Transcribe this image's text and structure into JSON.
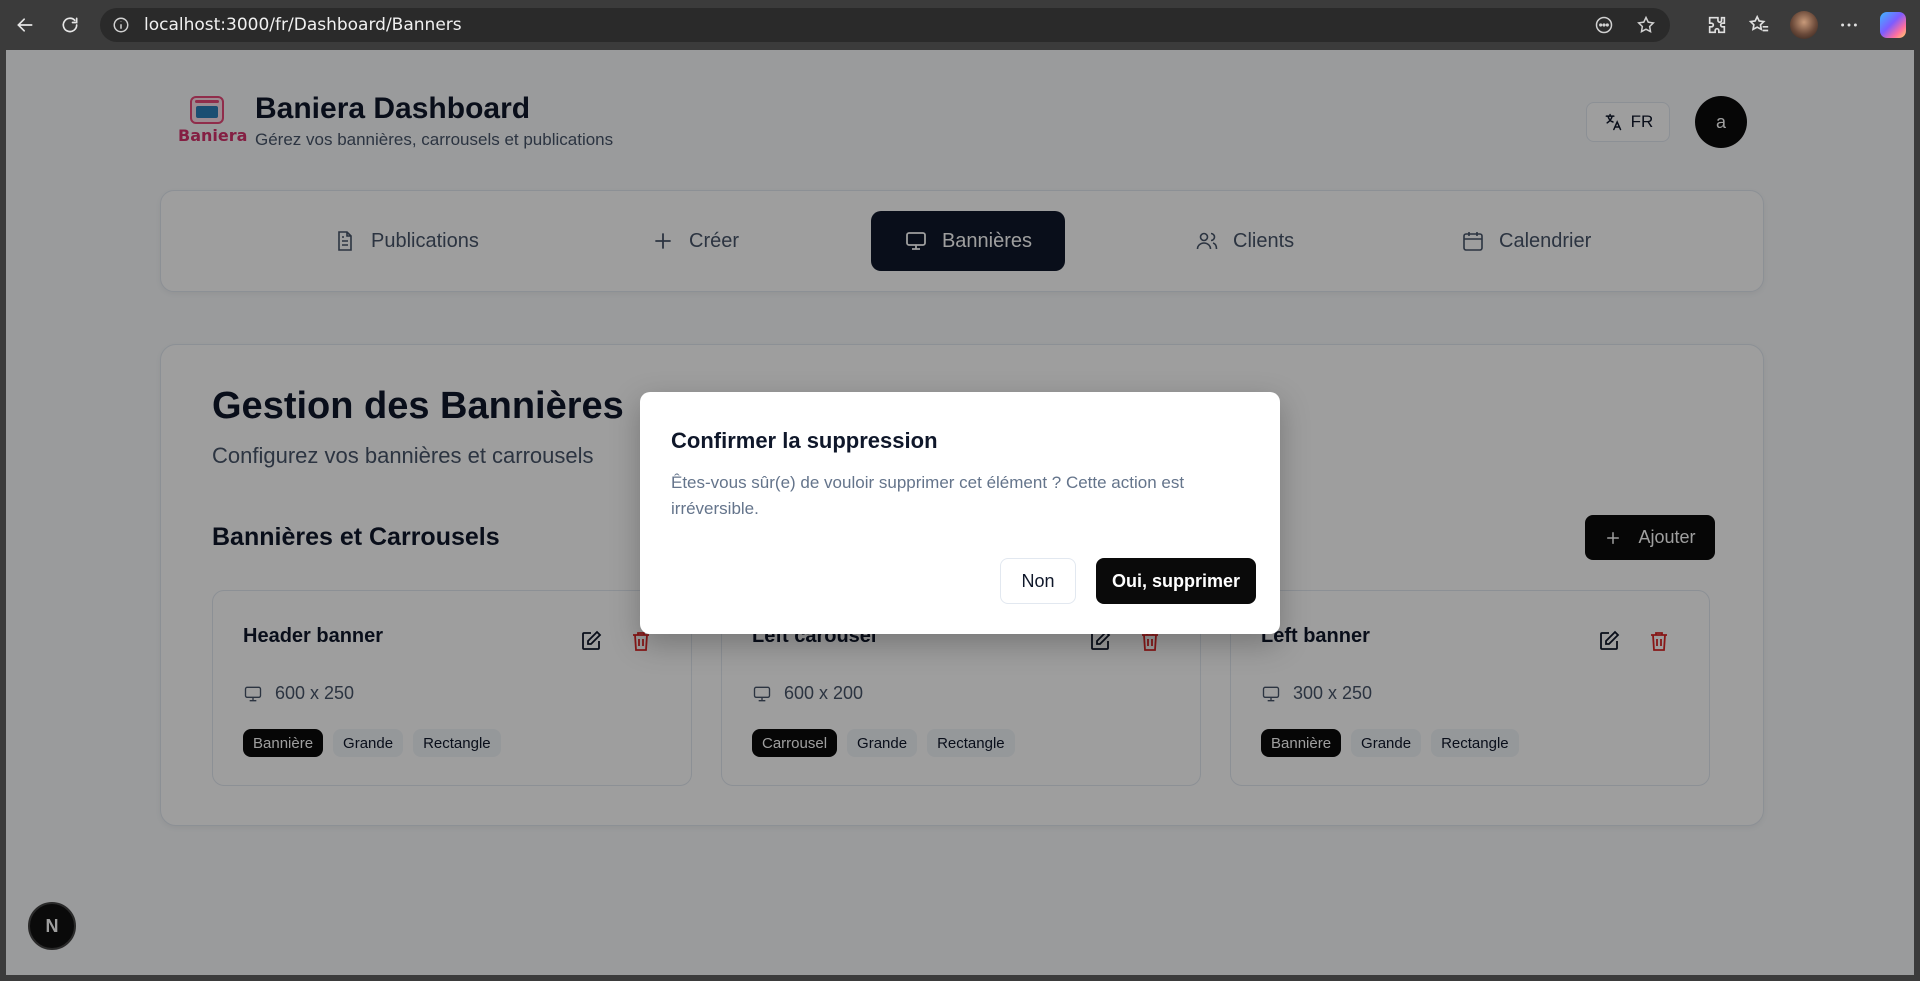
{
  "browser": {
    "url": "localhost:3000/fr/Dashboard/Banners"
  },
  "header": {
    "logo_text": "Baniera",
    "title": "Baniera Dashboard",
    "subtitle": "Gérez vos bannières, carrousels et publications",
    "language": "FR",
    "avatar_letter": "a"
  },
  "nav": {
    "items": [
      {
        "label": "Publications",
        "icon": "file-text-icon"
      },
      {
        "label": "Créer",
        "icon": "plus-icon"
      },
      {
        "label": "Bannières",
        "icon": "monitor-icon",
        "active": true
      },
      {
        "label": "Clients",
        "icon": "users-icon"
      },
      {
        "label": "Calendrier",
        "icon": "calendar-icon"
      }
    ]
  },
  "main": {
    "title": "Gestion des Bannières",
    "subtitle": "Configurez vos bannières et carrousels",
    "section_title": "Bannières et Carrousels",
    "add_label": "Ajouter",
    "cards": [
      {
        "name": "Header banner",
        "size": "600 x 250",
        "tags": [
          "Bannière",
          "Grande",
          "Rectangle"
        ]
      },
      {
        "name": "Left carousel",
        "size": "600 x 200",
        "tags": [
          "Carrousel",
          "Grande",
          "Rectangle"
        ]
      },
      {
        "name": "Left banner",
        "size": "300 x 250",
        "tags": [
          "Bannière",
          "Grande",
          "Rectangle"
        ]
      }
    ]
  },
  "dev_badge": "N",
  "dialog": {
    "title": "Confirmer la suppression",
    "text": "Êtes-vous sûr(e) de vouloir supprimer cet élément ? Cette action est irréversible.",
    "cancel_label": "Non",
    "confirm_label": "Oui, supprimer"
  },
  "colors": {
    "accent": "#0f172a",
    "danger": "#dc2626",
    "logo": "#d6336c"
  }
}
